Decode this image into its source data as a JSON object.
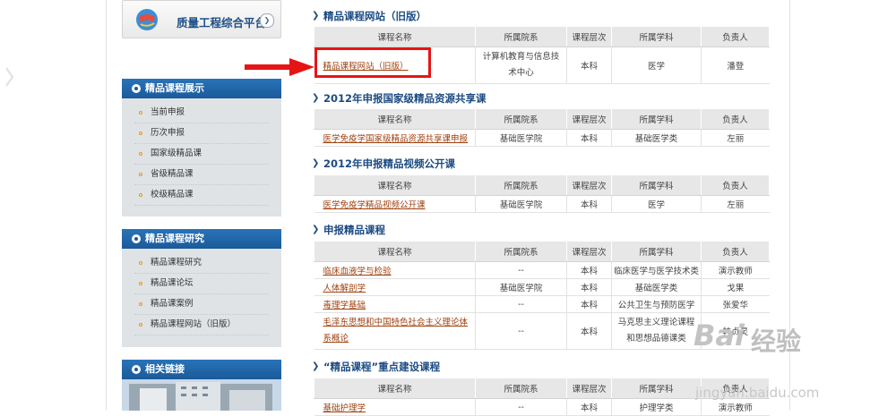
{
  "sidebar": {
    "quality_platform": "质量工程综合平台",
    "panels": [
      {
        "title": "精品课程展示",
        "items": [
          "当前申报",
          "历次申报",
          "国家级精品课",
          "省级精品课",
          "校级精品课"
        ]
      },
      {
        "title": "精品课程研究",
        "items": [
          "精品课程研究",
          "精品课论坛",
          "精品课案例",
          "精品课程网站（旧版）"
        ]
      },
      {
        "title": "相关链接",
        "items": []
      }
    ]
  },
  "main": {
    "headers": [
      "课程名称",
      "所属院系",
      "课程层次",
      "所属学科",
      "负责人"
    ],
    "sections": [
      {
        "title": "精品课程网站（旧版）",
        "rows": [
          [
            "精品课程网站（旧版）",
            "计算机教育与信息技术中心",
            "本科",
            "医学",
            "潘登"
          ]
        ]
      },
      {
        "title": "2012年申报国家级精品资源共享课",
        "rows": [
          [
            "医学免疫学国家级精品资源共享课申报",
            "基础医学院",
            "本科",
            "基础医学类",
            "左丽"
          ]
        ]
      },
      {
        "title": "2012年申报精品视频公开课",
        "rows": [
          [
            "医学免疫学精品视频公开课",
            "基础医学院",
            "本科",
            "医学",
            "左丽"
          ]
        ]
      },
      {
        "title": "申报精品课程",
        "rows": [
          [
            "临床血液学与检验",
            "--",
            "本科",
            "临床医学与医学技术类",
            "演示教师"
          ],
          [
            "人体解剖学",
            "基础医学院",
            "本科",
            "基础医学类",
            "戈果"
          ],
          [
            "毒理学基础",
            "--",
            "本科",
            "公共卫生与预防医学",
            "张爱华"
          ],
          [
            "毛泽东思想和中国特色社会主义理论体系概论",
            "--",
            "本科",
            "马克思主义理论课程和思想品德课类",
            "韩贞灵"
          ]
        ]
      },
      {
        "title": "“精品课程”重点建设课程",
        "rows": [
          [
            "基础护理学",
            "--",
            "本科",
            "护理学类",
            "演示教师"
          ]
        ]
      }
    ]
  },
  "watermark": {
    "brand": "Bai",
    "brand2": "经验",
    "url": "jingyan.baidu.com"
  }
}
